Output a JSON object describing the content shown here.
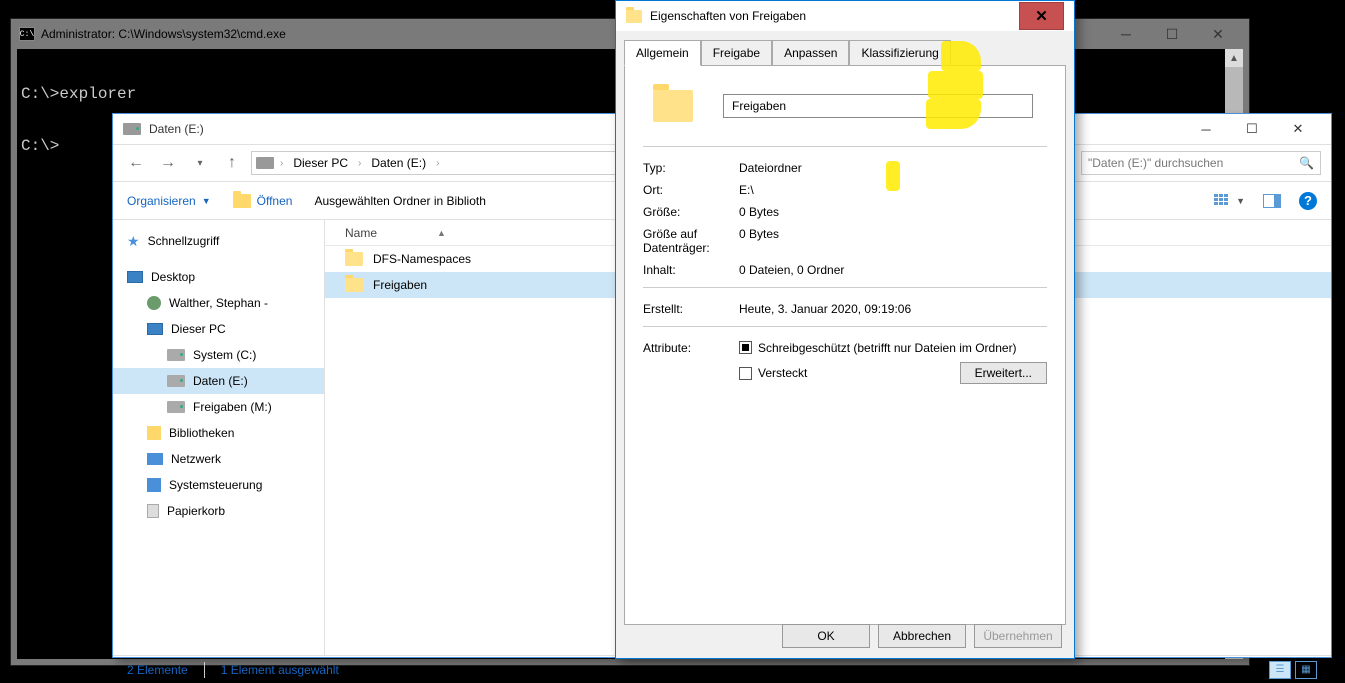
{
  "cmd": {
    "title": "Administrator: C:\\Windows\\system32\\cmd.exe",
    "lines": "\nC:\\>explorer\n\nC:\\>"
  },
  "explorer": {
    "title": "Daten (E:)",
    "breadcrumb": {
      "pc": "Dieser PC",
      "drive": "Daten (E:)"
    },
    "search_placeholder": "\"Daten (E:)\" durchsuchen",
    "toolbar": {
      "organize": "Organisieren",
      "open": "Öffnen",
      "include": "Ausgewählten Ordner in Biblioth"
    },
    "filelist": {
      "col_name": "Name",
      "items": [
        {
          "name": "DFS-Namespaces"
        },
        {
          "name": "Freigaben"
        }
      ]
    },
    "tree": {
      "quick": "Schnellzugriff",
      "desktop": "Desktop",
      "user": "Walther, Stephan - ",
      "pc": "Dieser PC",
      "c": "System (C:)",
      "e": "Daten (E:)",
      "m": "Freigaben (M:)",
      "lib": "Bibliotheken",
      "net": "Netzwerk",
      "ctrl": "Systemsteuerung",
      "trash": "Papierkorb"
    },
    "status": {
      "count": "2 Elemente",
      "selected": "1 Element ausgewählt"
    }
  },
  "props": {
    "title": "Eigenschaften von Freigaben",
    "tabs": {
      "general": "Allgemein",
      "share": "Freigabe",
      "customize": "Anpassen",
      "class": "Klassifizierung"
    },
    "name": "Freigaben",
    "rows": {
      "type_l": "Typ:",
      "type_v": "Dateiordner",
      "loc_l": "Ort:",
      "loc_v": "E:\\",
      "size_l": "Größe:",
      "size_v": "0 Bytes",
      "disk_l": "Größe auf Datenträger:",
      "disk_v": "0 Bytes",
      "cont_l": "Inhalt:",
      "cont_v": "0 Dateien, 0 Ordner",
      "created_l": "Erstellt:",
      "created_v": "Heute, 3. Januar 2020, 09:19:06",
      "attr_l": "Attribute:",
      "ro": "Schreibgeschützt (betrifft nur Dateien im Ordner)",
      "hidden": "Versteckt",
      "advanced": "Erweitert..."
    },
    "buttons": {
      "ok": "OK",
      "cancel": "Abbrechen",
      "apply": "Übernehmen"
    }
  }
}
